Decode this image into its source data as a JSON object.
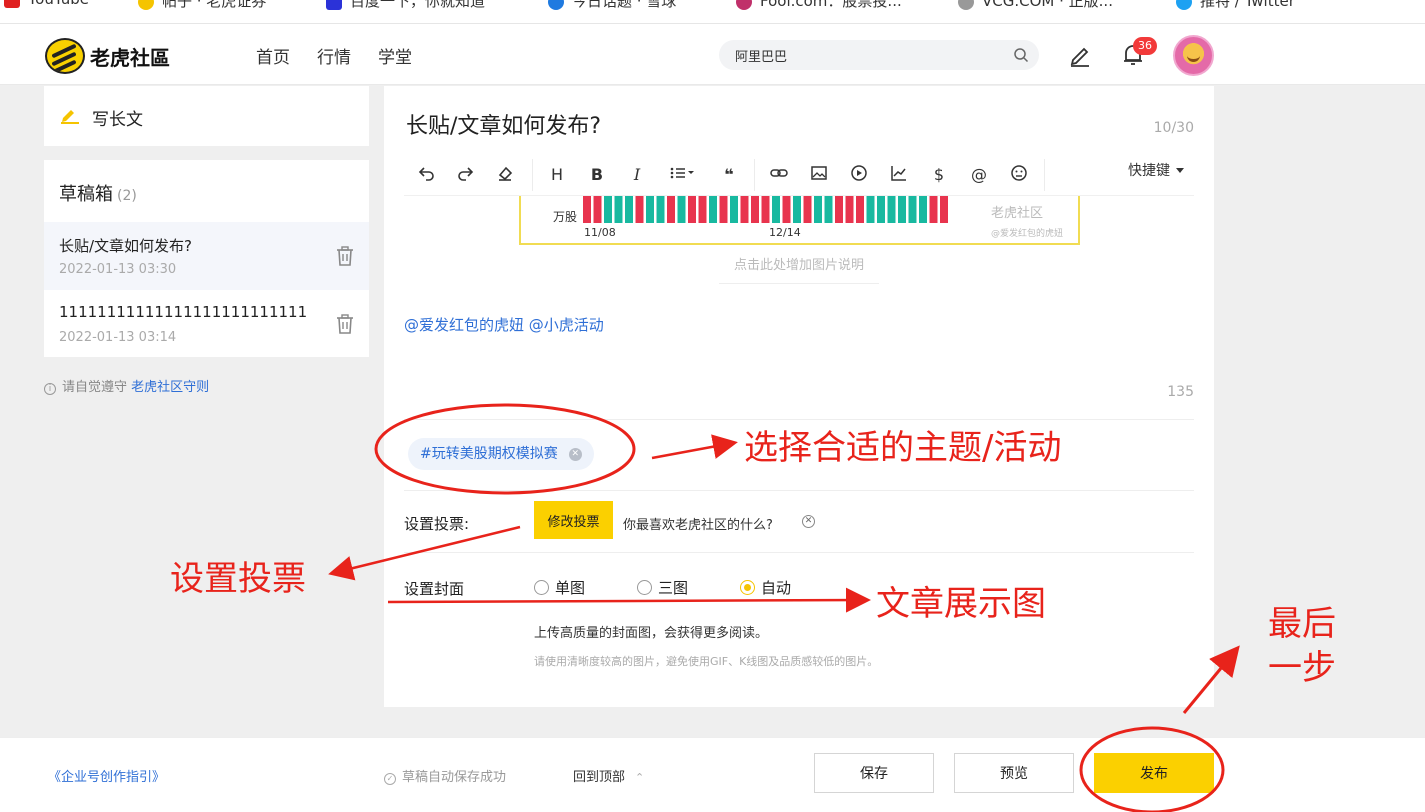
{
  "bookmarks": [
    {
      "label": "YouTube",
      "icon": "youtube-icon",
      "color": "#e02020"
    },
    {
      "label": "帖子 · 老虎证券",
      "icon": "tiger-icon",
      "color": "#f5c400"
    },
    {
      "label": "百度一下，你就知道",
      "icon": "baidu-icon",
      "color": "#2b32d8"
    },
    {
      "label": "今日话题 · 雪球",
      "icon": "xueqiu-icon",
      "color": "#1f7ae0"
    },
    {
      "label": "Fool.com：股票投...",
      "icon": "fool-icon",
      "color": "#c0306a"
    },
    {
      "label": "VCG.COM · 正版...",
      "icon": "vcg-icon",
      "color": "#999999"
    },
    {
      "label": "推特 / Twitter",
      "icon": "twitter-icon",
      "color": "#1da1f2"
    }
  ],
  "header": {
    "logo": "老虎社區",
    "nav": [
      "首页",
      "行情",
      "学堂"
    ],
    "search_value": "阿里巴巴",
    "notification_count": "36"
  },
  "sidebar": {
    "write_label": "写长文",
    "drafts_title": "草稿箱",
    "drafts_count": "(2)",
    "drafts": [
      {
        "title": "长贴/文章如何发布?",
        "date": "2022-01-13 03:30"
      },
      {
        "title": "11111111111111111111111111",
        "date": "2022-01-13 03:14"
      }
    ],
    "guide_prefix": "请自觉遵守",
    "guide_link": "老虎社区守则"
  },
  "editor": {
    "title": "长贴/文章如何发布?",
    "title_count": "10/30",
    "toolbar_shortcut": "快捷键",
    "image": {
      "unit_label": "万股",
      "x_labels": [
        "11/08",
        "12/14"
      ],
      "watermark": "老虎社区",
      "watermark_sub": "@爱发红包的虎妞"
    },
    "image_caption_placeholder": "点击此处增加图片说明",
    "mentions": "@爱发红包的虎妞 @小虎活动",
    "char_count": "135",
    "topic_tag": "#玩转美股期权模拟赛",
    "vote_label": "设置投票:",
    "vote_button": "修改投票",
    "vote_question": "你最喜欢老虎社区的什么?",
    "cover_label": "设置封面",
    "cover_options": [
      "单图",
      "三图",
      "自动"
    ],
    "cover_selected": "自动",
    "cover_tip": "上传高质量的封面图，会获得更多阅读。",
    "cover_note": "请使用清晰度较高的图片，避免使用GIF、K线图及品质感较低的图片。"
  },
  "footer": {
    "guide_link": "《企业号创作指引》",
    "autosave_status": "草稿自动保存成功",
    "back_to_top": "回到顶部",
    "save_button": "保存",
    "preview_button": "预览",
    "publish_button": "发布"
  },
  "annotations": {
    "topic": "选择合适的主题/活动",
    "vote": "设置投票",
    "cover": "文章展示图",
    "last_step_line1": "最后",
    "last_step_line2": "一步",
    "color": "#e8231b"
  },
  "colors": {
    "accent_yellow": "#fbd000",
    "link_blue": "#2f6fd6",
    "annotation_red": "#e8231b",
    "bar_red": "#e8344e",
    "bar_green": "#18b9a0"
  }
}
